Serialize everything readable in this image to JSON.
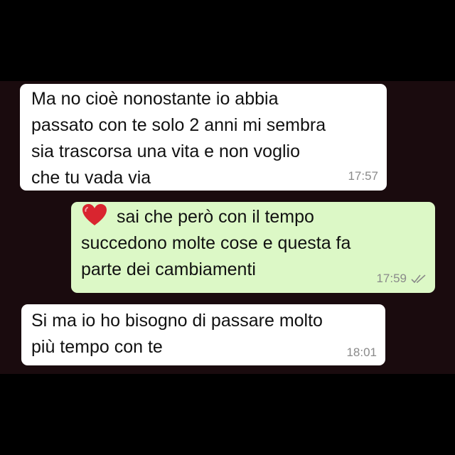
{
  "conversation": {
    "messages": [
      {
        "direction": "incoming",
        "text": "Ma no cioè nonostante io abbia\npassato con te solo 2 anni mi sembra\nsia trascorsa una vita e non voglio\nche tu vada via",
        "time": "17:57"
      },
      {
        "direction": "outgoing",
        "emoji": "red-heart-icon",
        "text": "sai che però con il tempo\nsuccedono molte cose e questa fa\nparte dei cambiamenti",
        "time": "17:59",
        "status": "read-double-check-icon"
      },
      {
        "direction": "incoming",
        "text": "Si ma io ho bisogno di passare molto\npiù tempo con te",
        "time": "18:01"
      }
    ]
  },
  "colors": {
    "incoming_bubble": "#ffffff",
    "outgoing_bubble": "#dcf8c6",
    "chat_background": "#1a0b0e",
    "frame": "#000000",
    "timestamp": "#8a8a8a",
    "heart": "#d9252f"
  }
}
